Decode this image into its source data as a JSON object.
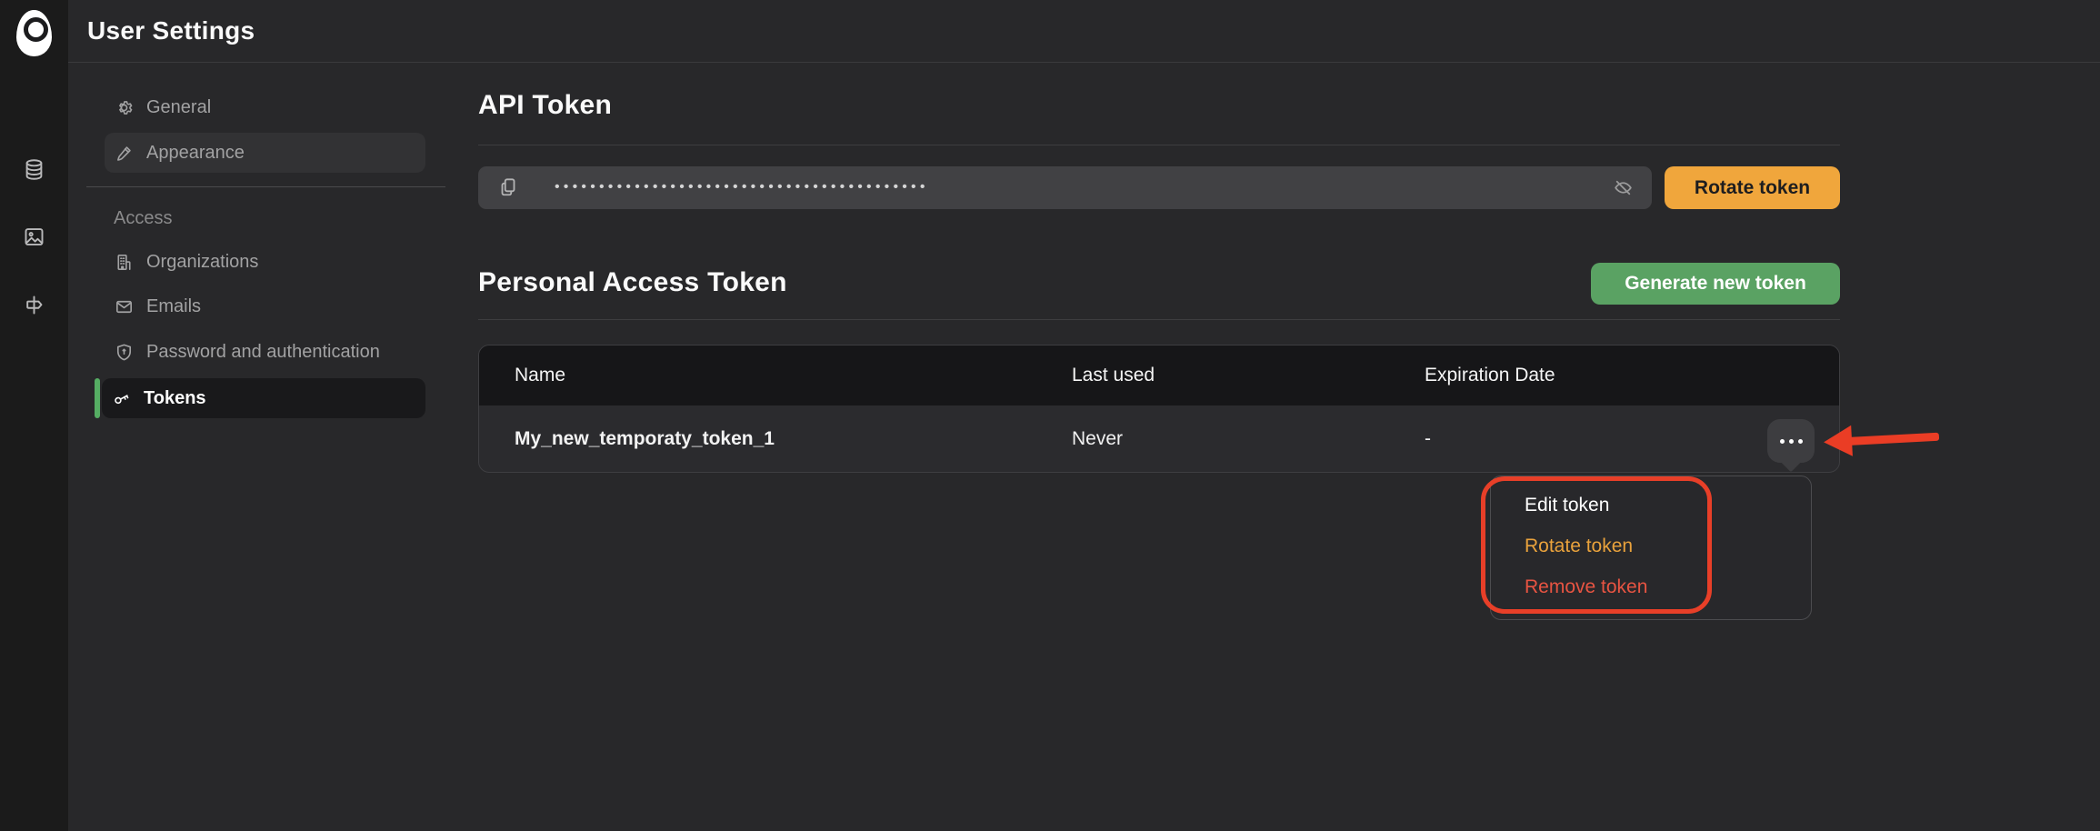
{
  "topbar": {
    "title": "User Settings"
  },
  "rail": {
    "icons": [
      {
        "name": "database"
      },
      {
        "name": "images"
      },
      {
        "name": "signpost"
      }
    ]
  },
  "nav": {
    "section_label": "Access",
    "items": [
      {
        "label": "General",
        "icon": "gear",
        "state": "default"
      },
      {
        "label": "Appearance",
        "icon": "paintbrush",
        "state": "hovered"
      },
      {
        "label": "Organizations",
        "icon": "building",
        "state": "default"
      },
      {
        "label": "Emails",
        "icon": "envelope",
        "state": "default"
      },
      {
        "label": "Password and authentication",
        "icon": "shield",
        "state": "default"
      },
      {
        "label": "Tokens",
        "icon": "key",
        "state": "active"
      }
    ]
  },
  "api_token": {
    "heading": "API Token",
    "masked_value": "••••••••••••••••••••••••••••••••••••••••••",
    "rotate_label": "Rotate token"
  },
  "personal_access": {
    "heading": "Personal Access Token",
    "generate_label": "Generate new token",
    "table": {
      "columns": [
        "Name",
        "Last used",
        "Expiration Date"
      ],
      "rows": [
        {
          "name": "My_new_temporaty_token_1",
          "last_used": "Never",
          "expiration": "-"
        }
      ]
    }
  },
  "row_menu": {
    "items": [
      {
        "label": "Edit token",
        "color": "#ffffff"
      },
      {
        "label": "Rotate token",
        "color": "#e9a23c"
      },
      {
        "label": "Remove token",
        "color": "#e85442"
      }
    ]
  },
  "colors": {
    "accent_orange": "#f0a63c",
    "accent_green": "#5aa263",
    "active_nav_green": "#55ad63",
    "annotation_red": "#e83f28"
  }
}
